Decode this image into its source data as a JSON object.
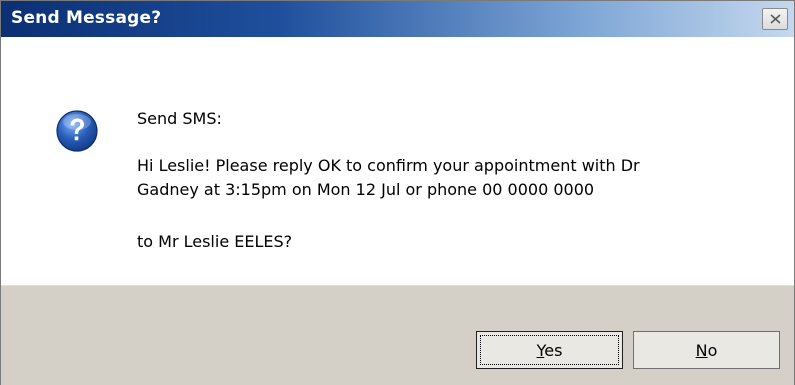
{
  "window": {
    "title": "Send Message?"
  },
  "message": {
    "heading": "Send SMS:",
    "body_line1": "Hi Leslie! Please reply OK to confirm your appointment with Dr",
    "body_line2": "Gadney at 3:15pm on Mon 12 Jul or phone 00 0000 0000",
    "recipient": "to Mr Leslie EELES?",
    "icon": "question-icon"
  },
  "buttons": {
    "yes": {
      "mnemonic": "Y",
      "rest": "es"
    },
    "no": {
      "mnemonic": "N",
      "rest": "o"
    }
  },
  "colors": {
    "titlebar_start": "#0b2f73",
    "titlebar_end": "#c4d8ee",
    "footer_bg": "#d4d0c8",
    "icon_blue": "#2a5db8"
  }
}
